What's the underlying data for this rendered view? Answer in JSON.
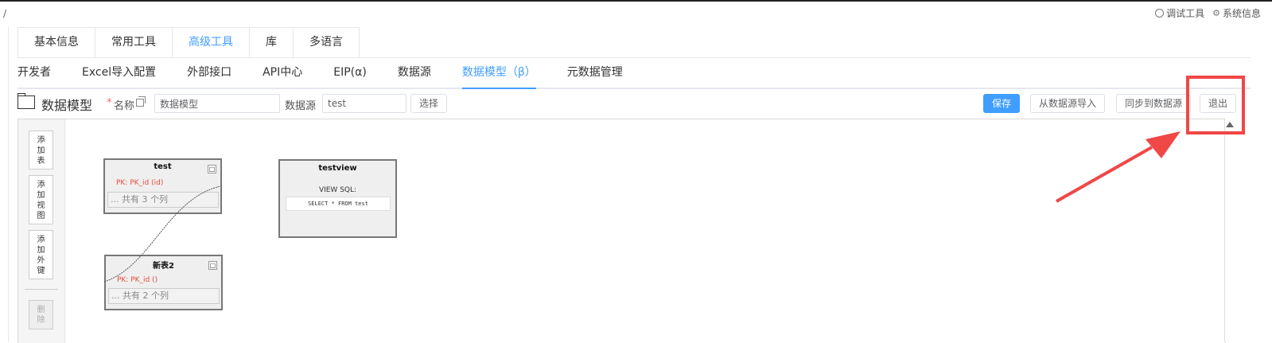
{
  "header": {
    "path": "/",
    "debug_tools": "调试工具",
    "system_info": "系统信息"
  },
  "main_tabs": [
    {
      "label": "基本信息",
      "active": false
    },
    {
      "label": "常用工具",
      "active": false
    },
    {
      "label": "高级工具",
      "active": true
    },
    {
      "label": "库",
      "active": false
    },
    {
      "label": "多语言",
      "active": false
    }
  ],
  "sub_tabs": [
    {
      "label": "开发者",
      "active": false
    },
    {
      "label": "Excel导入配置",
      "active": false
    },
    {
      "label": "外部接口",
      "active": false
    },
    {
      "label": "API中心",
      "active": false
    },
    {
      "label": "EIP(α)",
      "active": false
    },
    {
      "label": "数据源",
      "active": false
    },
    {
      "label": "数据模型（β）",
      "active": true
    },
    {
      "label": "元数据管理",
      "active": false
    }
  ],
  "toolbar": {
    "title": "数据模型",
    "required_mark": "*",
    "name_label": "名称",
    "name_value": "数据模型",
    "datasource_label": "数据源",
    "datasource_value": "test",
    "select_button": "选择",
    "save_button": "保存",
    "import_button": "从数据源导入",
    "sync_button": "同步到数据源",
    "exit_button": "退出"
  },
  "canvas_tools": {
    "add_table": "添\n加\n表",
    "add_view": "添\n加\n视\n图",
    "add_fk": "添\n加\n外\n键",
    "delete": "删\n除"
  },
  "nodes": {
    "test": {
      "title": "test",
      "pk": "PK: PK_id (id)",
      "columns": "... 共有 3 个列",
      "collapse": "□"
    },
    "testview": {
      "title": "testview",
      "sql_label": "VIEW SQL:",
      "sql": "SELECT * FROM test"
    },
    "new_table": {
      "title": "新表2",
      "pk": "PK: PK_id ()",
      "columns": "... 共有 2 个列",
      "collapse": "□"
    }
  },
  "colors": {
    "accent": "#409eff",
    "highlight": "#f04747",
    "pk_text": "#e74c3c"
  }
}
